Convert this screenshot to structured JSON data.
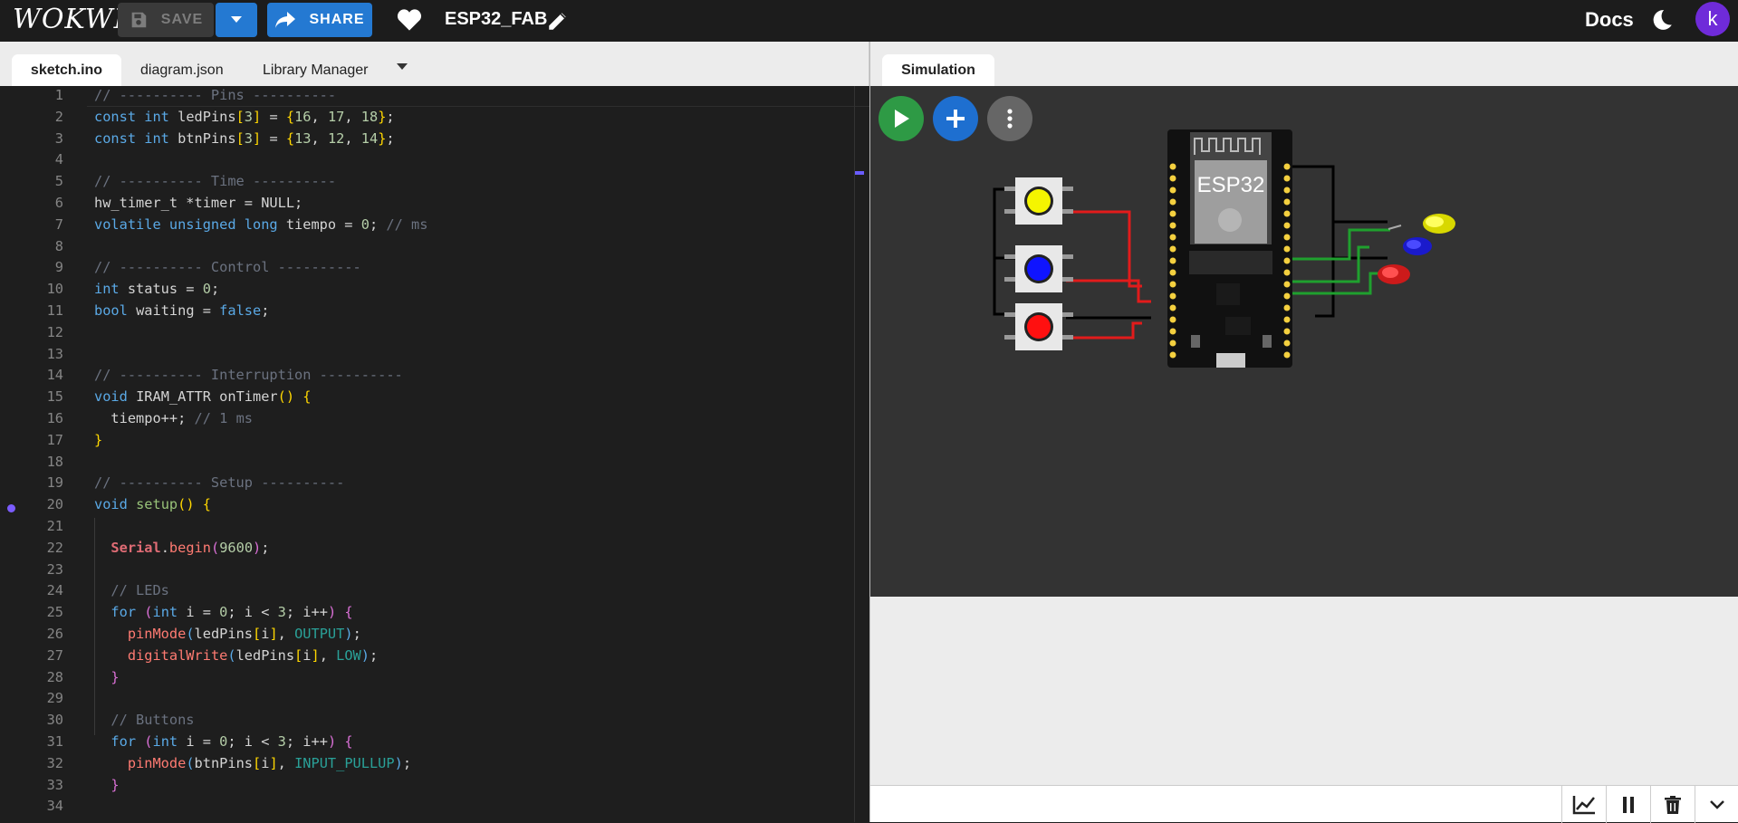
{
  "app": {
    "logo": "WOKWI",
    "project_name": "ESP32_FAB",
    "docs_label": "Docs",
    "avatar_letter": "k"
  },
  "toolbar": {
    "save_label": "SAVE",
    "share_label": "SHARE"
  },
  "editor_tabs": [
    "sketch.ino",
    "diagram.json",
    "Library Manager"
  ],
  "sim_tab": "Simulation",
  "chip_label": "ESP32",
  "colors": {
    "accent": "#2479d2",
    "play": "#2e9a45",
    "add": "#1e6fd0",
    "avatar": "#6f2bd9"
  },
  "code": {
    "line_numbers": [
      "1",
      "2",
      "3",
      "4",
      "5",
      "6",
      "7",
      "8",
      "9",
      "10",
      "11",
      "12",
      "13",
      "14",
      "15",
      "16",
      "17",
      "18",
      "19",
      "20",
      "21",
      "22",
      "23",
      "24",
      "25",
      "26",
      "27",
      "28",
      "29",
      "30",
      "31",
      "32",
      "33",
      "34"
    ],
    "lines": [
      [
        [
          "c-com",
          "// ---------- Pins ----------"
        ]
      ],
      [
        [
          "c-kw",
          "const int "
        ],
        [
          "c-punc",
          "ledPins"
        ],
        [
          "c-br",
          "["
        ],
        [
          "c-num",
          "3"
        ],
        [
          "c-br",
          "]"
        ],
        [
          "c-punc",
          " = "
        ],
        [
          "c-br",
          "{"
        ],
        [
          "c-num",
          "16"
        ],
        [
          "c-punc",
          ", "
        ],
        [
          "c-num",
          "17"
        ],
        [
          "c-punc",
          ", "
        ],
        [
          "c-num",
          "18"
        ],
        [
          "c-br",
          "}"
        ],
        [
          "c-punc",
          ";"
        ]
      ],
      [
        [
          "c-kw",
          "const int "
        ],
        [
          "c-punc",
          "btnPins"
        ],
        [
          "c-br",
          "["
        ],
        [
          "c-num",
          "3"
        ],
        [
          "c-br",
          "]"
        ],
        [
          "c-punc",
          " = "
        ],
        [
          "c-br",
          "{"
        ],
        [
          "c-num",
          "13"
        ],
        [
          "c-punc",
          ", "
        ],
        [
          "c-num",
          "12"
        ],
        [
          "c-punc",
          ", "
        ],
        [
          "c-num",
          "14"
        ],
        [
          "c-br",
          "}"
        ],
        [
          "c-punc",
          ";"
        ]
      ],
      [],
      [
        [
          "c-com",
          "// ---------- Time ----------"
        ]
      ],
      [
        [
          "c-punc",
          "hw_timer_t *timer = NULL;"
        ]
      ],
      [
        [
          "c-kw",
          "volatile unsigned long "
        ],
        [
          "c-punc",
          "tiempo = "
        ],
        [
          "c-num",
          "0"
        ],
        [
          "c-punc",
          "; "
        ],
        [
          "c-com",
          "// ms"
        ]
      ],
      [],
      [
        [
          "c-com",
          "// ---------- Control ----------"
        ]
      ],
      [
        [
          "c-kw",
          "int "
        ],
        [
          "c-punc",
          "status = "
        ],
        [
          "c-num",
          "0"
        ],
        [
          "c-punc",
          ";"
        ]
      ],
      [
        [
          "c-kw",
          "bool "
        ],
        [
          "c-punc",
          "waiting = "
        ],
        [
          "c-kw",
          "false"
        ],
        [
          "c-punc",
          ";"
        ]
      ],
      [],
      [],
      [
        [
          "c-com",
          "// ---------- Interruption ----------"
        ]
      ],
      [
        [
          "c-kw",
          "void "
        ],
        [
          "c-punc",
          "IRAM_ATTR onTimer"
        ],
        [
          "c-br",
          "() {"
        ]
      ],
      [
        [
          "c-punc",
          "  tiempo++; "
        ],
        [
          "c-com",
          "// 1 ms"
        ]
      ],
      [
        [
          "c-br",
          "}"
        ]
      ],
      [],
      [
        [
          "c-com",
          "// ---------- Setup ----------"
        ]
      ],
      [
        [
          "c-kw",
          "void "
        ],
        [
          "c-sfn",
          "setup"
        ],
        [
          "c-br",
          "() {"
        ]
      ],
      [],
      [
        [
          "c-punc",
          "  "
        ],
        [
          "c-ser",
          "Serial"
        ],
        [
          "c-punc",
          "."
        ],
        [
          "c-fn",
          "begin"
        ],
        [
          "c-mag",
          "("
        ],
        [
          "c-num",
          "9600"
        ],
        [
          "c-mag",
          ")"
        ],
        [
          "c-punc",
          ";"
        ]
      ],
      [],
      [
        [
          "c-com",
          "  // LEDs"
        ]
      ],
      [
        [
          "c-kw",
          "  for "
        ],
        [
          "c-mag",
          "("
        ],
        [
          "c-kw",
          "int "
        ],
        [
          "c-punc",
          "i = "
        ],
        [
          "c-num",
          "0"
        ],
        [
          "c-punc",
          "; i < "
        ],
        [
          "c-num",
          "3"
        ],
        [
          "c-punc",
          "; i++"
        ],
        [
          "c-mag",
          ")"
        ],
        [
          "c-punc",
          " "
        ],
        [
          "c-mag",
          "{"
        ]
      ],
      [
        [
          "c-punc",
          "    "
        ],
        [
          "c-fn",
          "pinMode"
        ],
        [
          "c-kw",
          "("
        ],
        [
          "c-punc",
          "ledPins"
        ],
        [
          "c-br",
          "["
        ],
        [
          "c-punc",
          "i"
        ],
        [
          "c-br",
          "]"
        ],
        [
          "c-punc",
          ", "
        ],
        [
          "c-con",
          "OUTPUT"
        ],
        [
          "c-kw",
          ")"
        ],
        [
          "c-punc",
          ";"
        ]
      ],
      [
        [
          "c-punc",
          "    "
        ],
        [
          "c-fn",
          "digitalWrite"
        ],
        [
          "c-kw",
          "("
        ],
        [
          "c-punc",
          "ledPins"
        ],
        [
          "c-br",
          "["
        ],
        [
          "c-punc",
          "i"
        ],
        [
          "c-br",
          "]"
        ],
        [
          "c-punc",
          ", "
        ],
        [
          "c-con",
          "LOW"
        ],
        [
          "c-kw",
          ")"
        ],
        [
          "c-punc",
          ";"
        ]
      ],
      [
        [
          "c-mag",
          "  }"
        ]
      ],
      [],
      [
        [
          "c-com",
          "  // Buttons"
        ]
      ],
      [
        [
          "c-kw",
          "  for "
        ],
        [
          "c-mag",
          "("
        ],
        [
          "c-kw",
          "int "
        ],
        [
          "c-punc",
          "i = "
        ],
        [
          "c-num",
          "0"
        ],
        [
          "c-punc",
          "; i < "
        ],
        [
          "c-num",
          "3"
        ],
        [
          "c-punc",
          "; i++"
        ],
        [
          "c-mag",
          ")"
        ],
        [
          "c-punc",
          " "
        ],
        [
          "c-mag",
          "{"
        ]
      ],
      [
        [
          "c-punc",
          "    "
        ],
        [
          "c-fn",
          "pinMode"
        ],
        [
          "c-kw",
          "("
        ],
        [
          "c-punc",
          "btnPins"
        ],
        [
          "c-br",
          "["
        ],
        [
          "c-punc",
          "i"
        ],
        [
          "c-br",
          "]"
        ],
        [
          "c-punc",
          ", "
        ],
        [
          "c-con",
          "INPUT_PULLUP"
        ],
        [
          "c-kw",
          ")"
        ],
        [
          "c-punc",
          ";"
        ]
      ],
      [
        [
          "c-mag",
          "  }"
        ]
      ],
      []
    ]
  }
}
